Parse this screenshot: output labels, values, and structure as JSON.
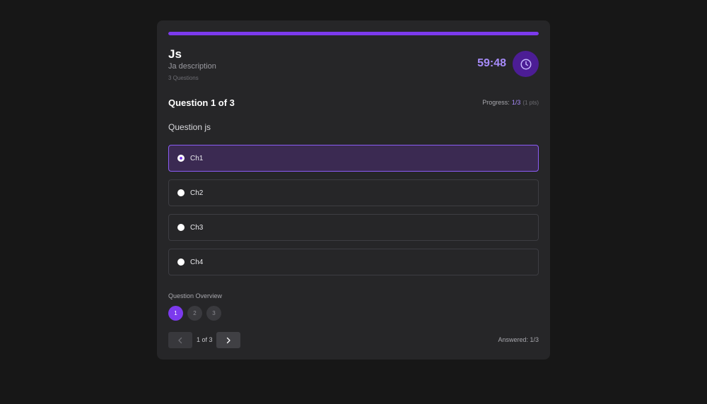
{
  "quiz": {
    "title": "Js",
    "description": "Ja description",
    "question_count": "3 Questions",
    "timer": "59:48",
    "overall_progress": 1.0
  },
  "question": {
    "heading": "Question 1 of 3",
    "text": "Question js",
    "progress_label": "Progress:",
    "progress_value": "1/3",
    "points": "(1 pts)"
  },
  "choices": [
    {
      "label": "Ch1",
      "selected": true
    },
    {
      "label": "Ch2",
      "selected": false
    },
    {
      "label": "Ch3",
      "selected": false
    },
    {
      "label": "Ch4",
      "selected": false
    }
  ],
  "overview": {
    "label": "Question Overview",
    "items": [
      "1",
      "2",
      "3"
    ],
    "current": "1"
  },
  "pagination": {
    "page_indicator": "1 of 3",
    "answered": "Answered: 1/3"
  },
  "icons": {
    "timer": "clock-icon",
    "prev": "chevron-left-icon",
    "next": "chevron-right-icon"
  },
  "colors": {
    "accent": "#7c3aed",
    "accent_light": "#a78bfa",
    "background": "#171717",
    "card": "#262628"
  }
}
